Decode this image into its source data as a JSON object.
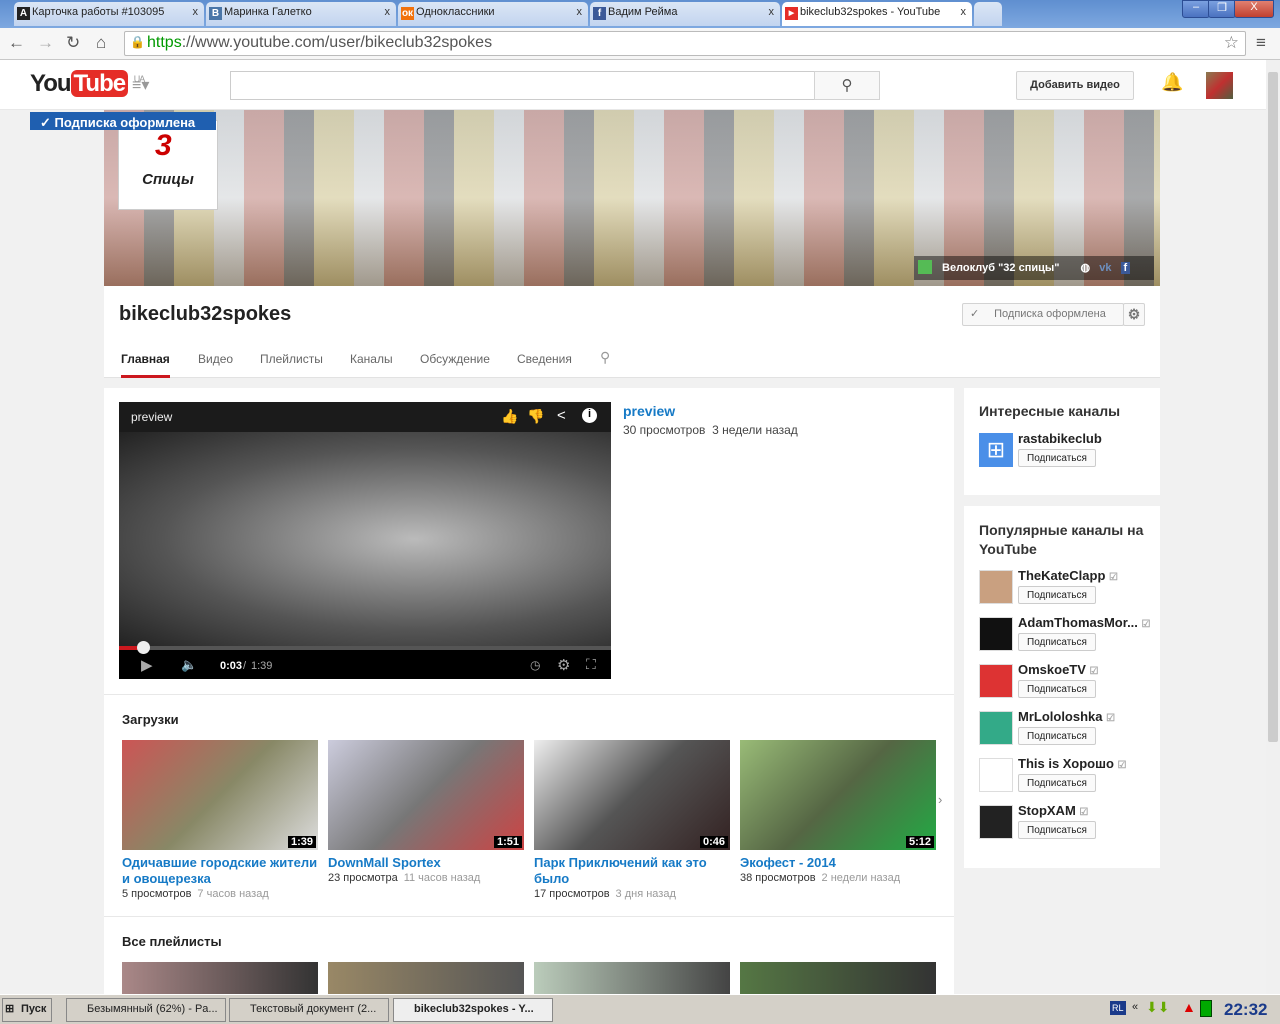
{
  "browser": {
    "tabs": [
      {
        "label": "Карточка работы #103095",
        "icon": "A",
        "color": "#222"
      },
      {
        "label": "Маринка Галетко",
        "icon": "B",
        "color": "#4a76a8"
      },
      {
        "label": "Одноклассники",
        "icon": "ok",
        "color": "#f2720c"
      },
      {
        "label": "Вадим Рейма",
        "icon": "f",
        "color": "#3b5998"
      },
      {
        "label": "bikeclub32spokes - YouTube",
        "icon": "▶",
        "color": "#e52d27"
      }
    ],
    "url_scheme": "https",
    "url_rest": "://www.youtube.com/user/bikeclub32spokes",
    "close": "x"
  },
  "yt": {
    "logo_you": "You",
    "logo_tube": "Tube",
    "region": "UA",
    "upload": "Добавить видео",
    "search_placeholder": ""
  },
  "banner": {
    "subscribed_flag": "✓  Подписка оформлена",
    "logo_text": "Спицы",
    "caption": "Велоклуб \"32 спицы\""
  },
  "channel": {
    "name": "bikeclub32spokes",
    "subscribe": "Подписка оформлена",
    "tabs": [
      "Главная",
      "Видео",
      "Плейлисты",
      "Каналы",
      "Обсуждение",
      "Сведения"
    ]
  },
  "featured": {
    "title": "preview",
    "overlay_title": "preview",
    "views": "30 просмотров",
    "age": "3 недели назад",
    "time": "0:03",
    "duration": "1:39",
    "progress": 0.045
  },
  "uploads": {
    "heading": "Загрузки",
    "items": [
      {
        "title": "Одичавшие городские жители и овощерезка",
        "views": "5 просмотров",
        "age": "7 часов назад",
        "dur": "1:39"
      },
      {
        "title": "DownMall Sportex",
        "views": "23 просмотра",
        "age": "11 часов назад",
        "dur": "1:51"
      },
      {
        "title": "Парк Приключений как это было",
        "views": "17 просмотров",
        "age": "3 дня назад",
        "dur": "0:46"
      },
      {
        "title": "Экофест - 2014",
        "views": "38 просмотров",
        "age": "2 недели назад",
        "dur": "5:12"
      }
    ]
  },
  "playlists": {
    "heading": "Все плейлисты"
  },
  "sidebar": {
    "interesting": "Интересные каналы",
    "popular": "Популярные каналы на YouTube",
    "subscribe": "Подписаться",
    "interesting_channels": [
      {
        "name": "rastabikeclub"
      }
    ],
    "popular_channels": [
      {
        "name": "TheKateClapp"
      },
      {
        "name": "AdamThomasMor..."
      },
      {
        "name": "OmskoeTV"
      },
      {
        "name": "MrLololoshka"
      },
      {
        "name": "This is Хорошо"
      },
      {
        "name": "StopXAM"
      }
    ]
  },
  "taskbar": {
    "start": "Пуск",
    "items": [
      "Безымянный (62%) - Pa...",
      "Текстовый документ (2...",
      "bikeclub32spokes - Y..."
    ],
    "lang": "RL",
    "clock": "22:32"
  }
}
